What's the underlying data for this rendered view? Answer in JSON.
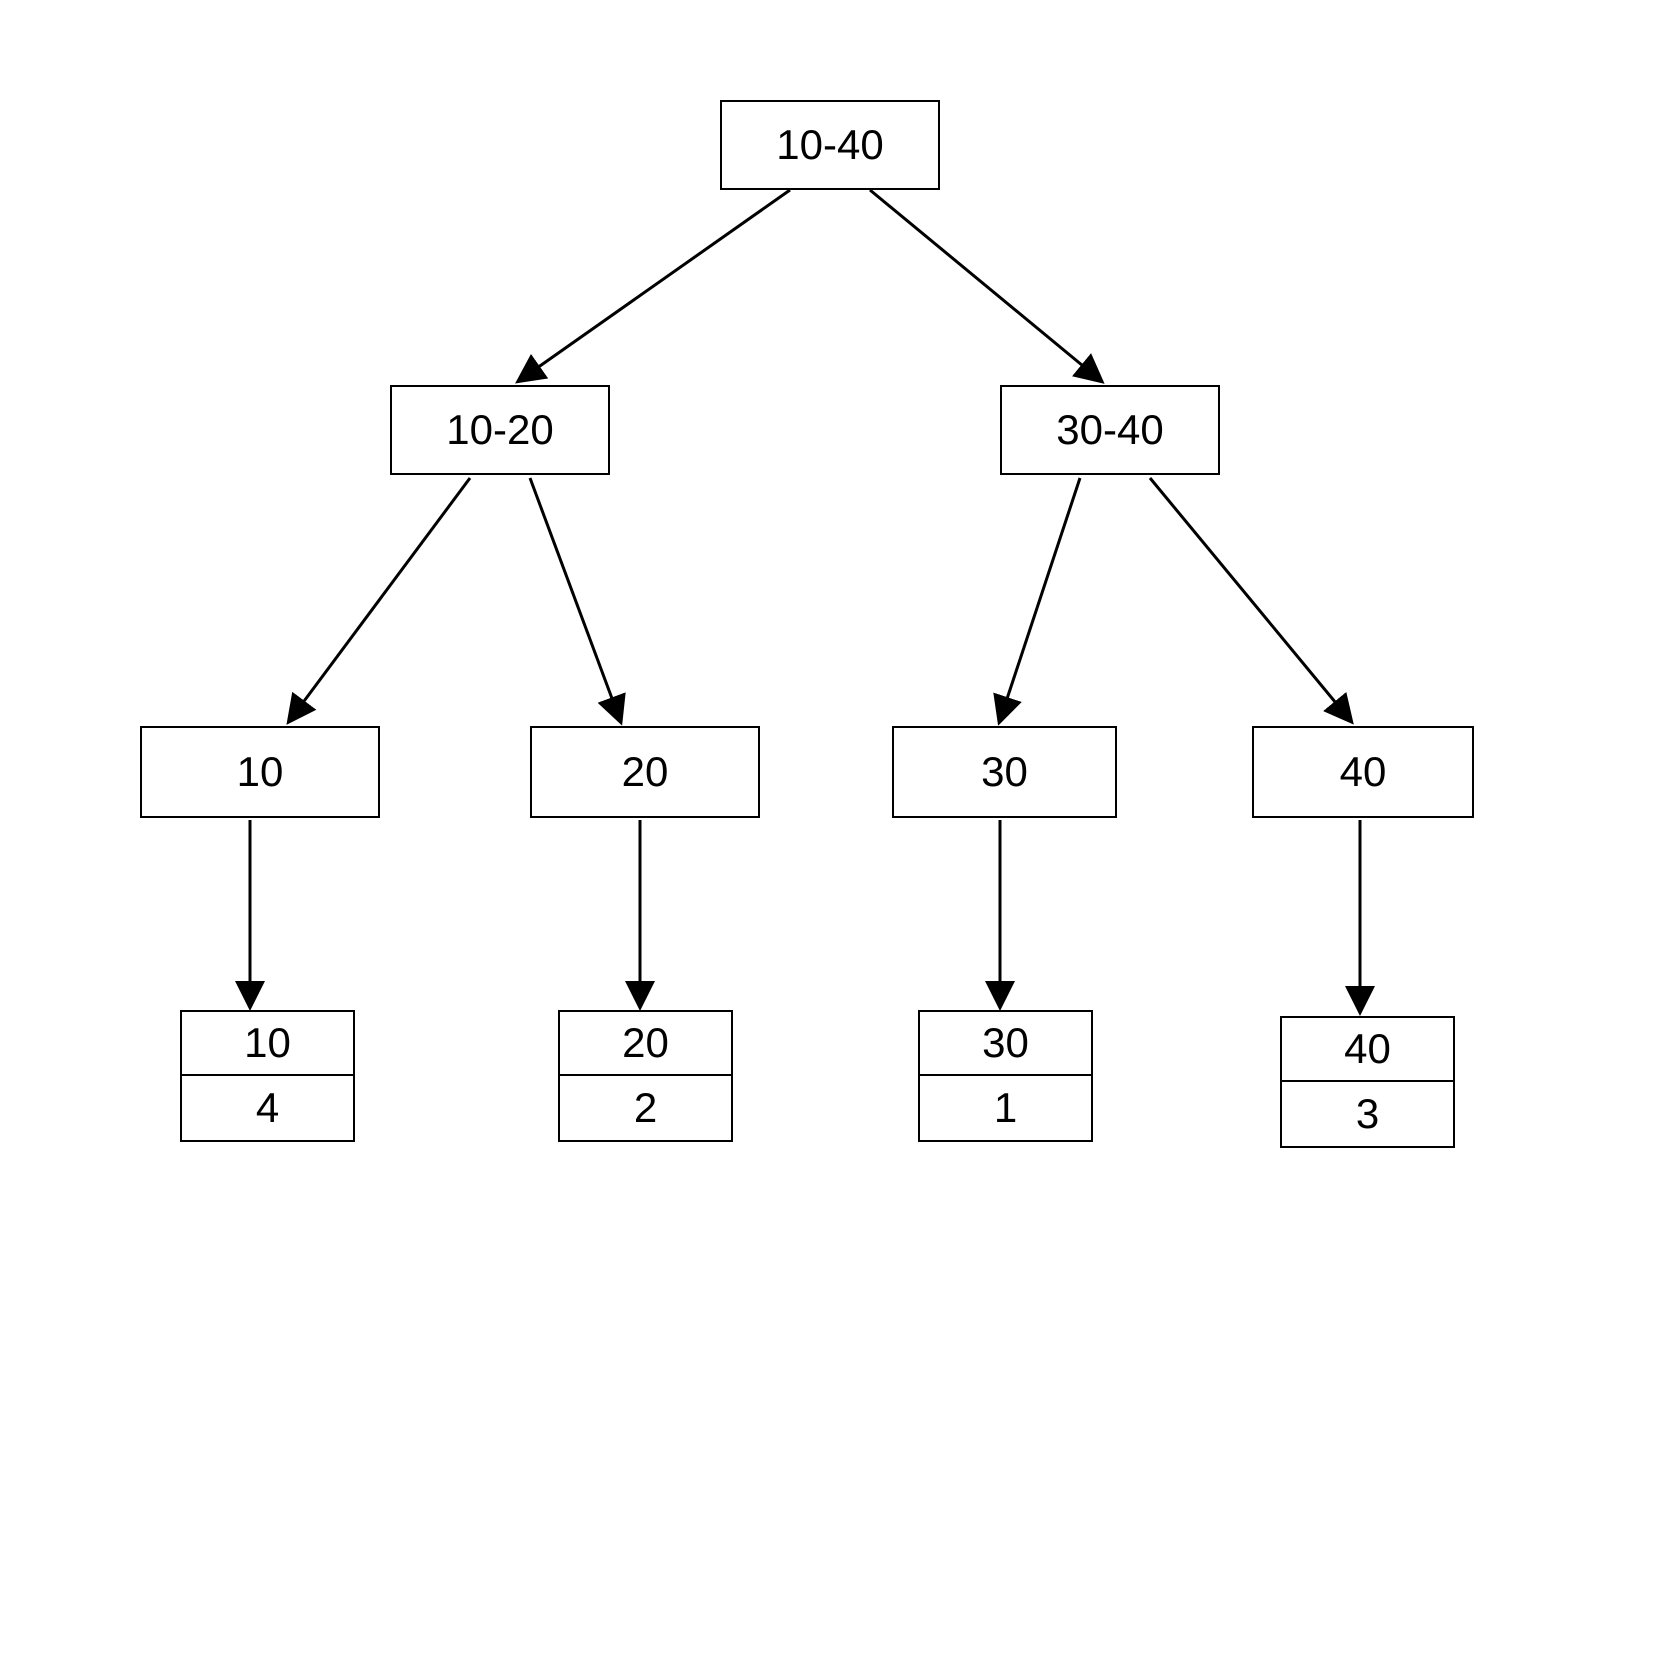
{
  "tree": {
    "root": {
      "label": "10-40"
    },
    "level1": {
      "left": {
        "label": "10-20"
      },
      "right": {
        "label": "30-40"
      }
    },
    "level2": {
      "n1": {
        "label": "10"
      },
      "n2": {
        "label": "20"
      },
      "n3": {
        "label": "30"
      },
      "n4": {
        "label": "40"
      }
    },
    "leaves": {
      "l1": {
        "top": "10",
        "bottom": "4"
      },
      "l2": {
        "top": "20",
        "bottom": "2"
      },
      "l3": {
        "top": "30",
        "bottom": "1"
      },
      "l4": {
        "top": "40",
        "bottom": "3"
      }
    }
  }
}
